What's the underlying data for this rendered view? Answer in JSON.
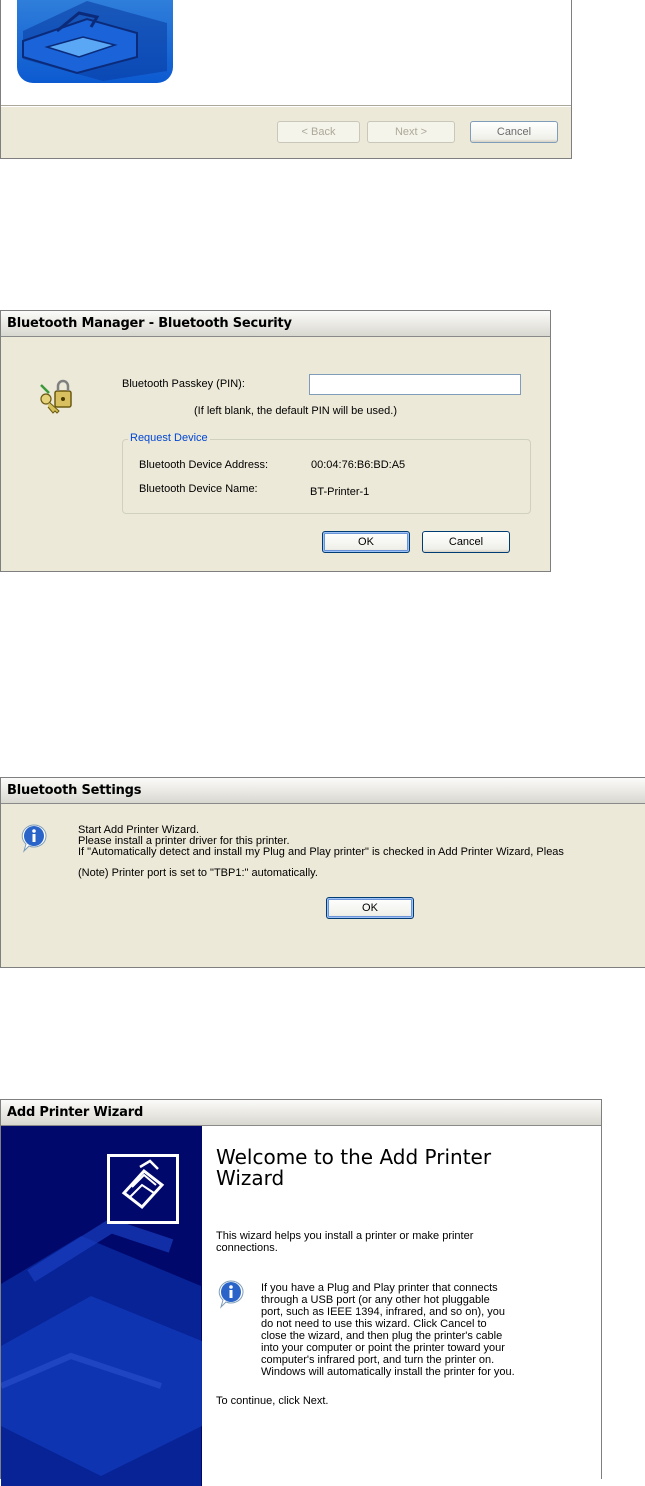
{
  "dialog1": {
    "buttons": {
      "back": "< Back",
      "next": "Next >",
      "cancel": "Cancel"
    },
    "icon": "printer-wizard-icon"
  },
  "dialog2": {
    "title": "Bluetooth Manager - Bluetooth Security",
    "passkey_label": "Bluetooth Passkey (PIN):",
    "passkey_value": "",
    "hint": "(If left blank, the default PIN will be used.)",
    "group_title": "Request Device",
    "address_label": "Bluetooth Device Address:",
    "address_value": "00:04:76:B6:BD:A5",
    "name_label": "Bluetooth Device Name:",
    "name_value": "BT-Printer-1",
    "ok": "OK",
    "cancel": "Cancel",
    "icon": "keys-lock-icon",
    "accent": "#0046d5"
  },
  "dialog3": {
    "title": "Bluetooth Settings",
    "line1": "Start Add Printer Wizard.",
    "line2": "Please install a printer driver for this printer.",
    "line3": "If \"Automatically detect and install my Plug and Play printer\" is checked in Add Printer Wizard, Pleas",
    "note": "(Note) Printer port is set to \"TBP1:\" automatically.",
    "ok": "OK",
    "icon": "info-icon"
  },
  "dialog4": {
    "title": "Add Printer Wizard",
    "heading_line1": "Welcome to the Add Printer",
    "heading_line2": "Wizard",
    "intro_line1": "This wizard helps you install a printer or make printer",
    "intro_line2": "connections.",
    "info_lines": [
      "If you have a Plug and Play printer that connects",
      "through a USB port (or any other hot pluggable",
      "port, such as IEEE 1394, infrared, and so on), you",
      "do not need to use this wizard. Click Cancel to",
      "close the wizard, and then plug the printer's cable",
      "into your computer or point the printer toward your",
      "computer's infrared port, and turn the printer on.",
      "Windows will automatically install the printer for you."
    ],
    "continue": "To continue, click Next.",
    "left_color": "#00086b"
  }
}
